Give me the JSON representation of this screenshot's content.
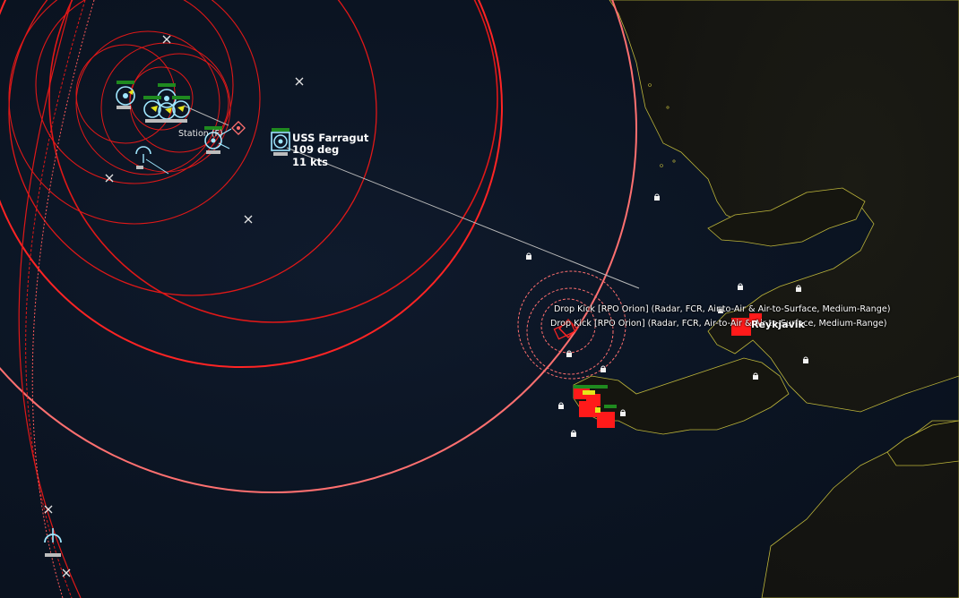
{
  "selected_unit": {
    "name": "USS Farragut",
    "course": "109 deg",
    "speed": "11 kts"
  },
  "reference_points": {
    "station_label": "Station (F)"
  },
  "contacts": [
    {
      "label": "Drop Kick [RPO Orion] (Radar, FCR, Air-to-Air & Air-to-Surface, Medium-Range)"
    },
    {
      "label": "Drop Kick [RPO Orion] (Radar, FCR, Air-to-Air & Air-to-Surface, Medium-Range)"
    }
  ],
  "places": {
    "city": "Reykjavik"
  },
  "colors": {
    "ocean": "#0b1422",
    "land": "#14140f",
    "coastline": "#bdb53a",
    "friendly": "#9fe7ff",
    "hostile": "#ff1a1a",
    "range_ring": "#ff2b2b",
    "outer_ring": "#ff7a7a",
    "facility_green": "#1f8a1f"
  }
}
